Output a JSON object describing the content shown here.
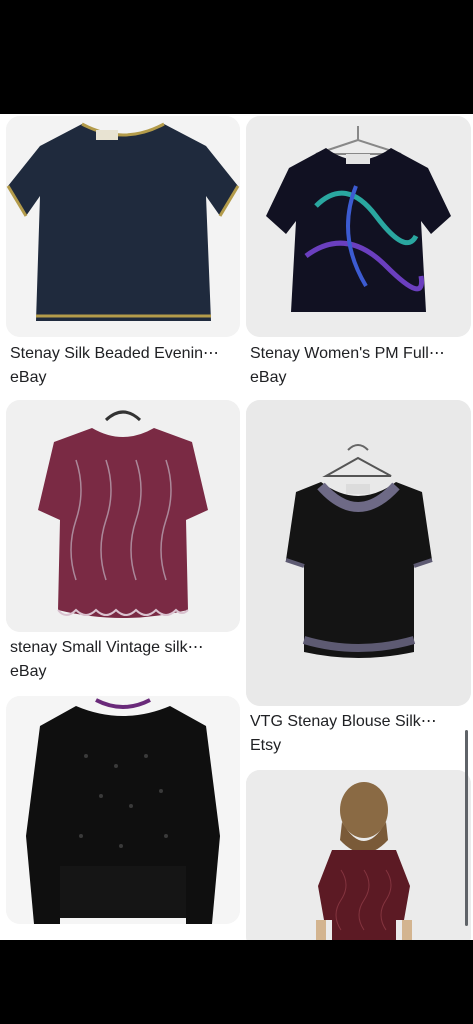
{
  "results": [
    {
      "title": "Stenay Silk Beaded Evenin⋯",
      "source": "eBay",
      "image": "navy-beaded-top-gold-trim"
    },
    {
      "title": "Stenay Women's PM Full⋯",
      "source": "eBay",
      "image": "black-sequin-top-blue-purple-swirls"
    },
    {
      "title": "stenay Small Vintage silk⋯",
      "source": "eBay",
      "image": "burgundy-beaded-top-scalloped"
    },
    {
      "title": "VTG Stenay Blouse Silk⋯",
      "source": "Etsy",
      "image": "black-beaded-blouse-floral-neckline"
    },
    {
      "title": "",
      "source": "",
      "image": "black-beaded-long-sleeve-top"
    },
    {
      "title": "",
      "source": "",
      "image": "model-back-burgundy-beaded-top"
    }
  ],
  "colors": {
    "navy": "#1f2a3d",
    "gold": "#b39b4a",
    "burgundy": "#7a2a44",
    "black": "#111111"
  }
}
